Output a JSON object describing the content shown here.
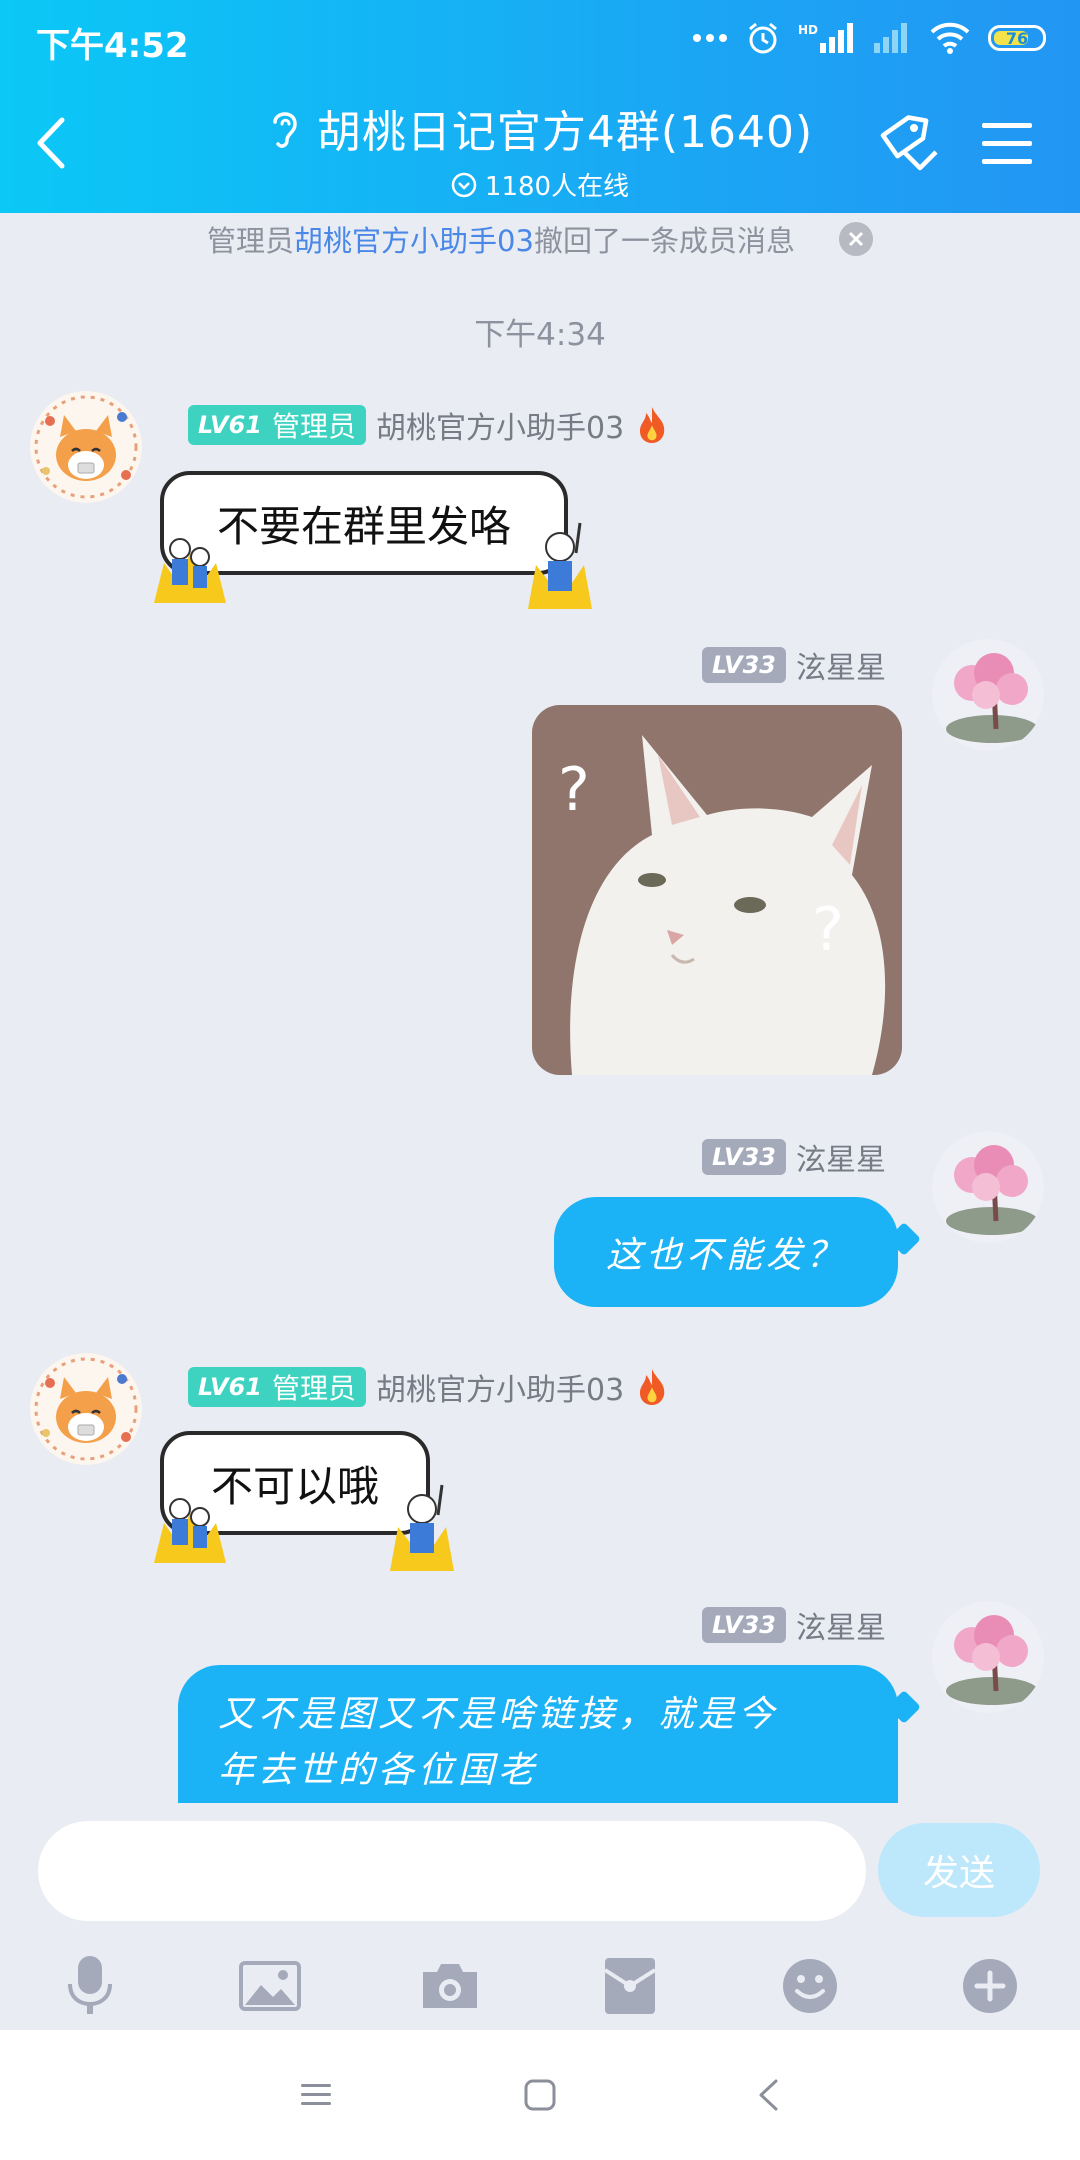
{
  "status_bar": {
    "time": "下午4:52",
    "battery": "76",
    "network": "HD"
  },
  "header": {
    "title": "胡桃日记官方4群(1640)",
    "online": "1180人在线"
  },
  "system_notice": {
    "prefix": "管理员",
    "name": "胡桃官方小助手03",
    "suffix": "撤回了一条成员消息"
  },
  "timestamp": "下午4:34",
  "messages": [
    {
      "sender": "胡桃官方小助手03",
      "level": "LV61",
      "role": "管理员",
      "text": "不要在群里发咯"
    },
    {
      "sender": "泫星星",
      "level": "LV33",
      "image_marks": [
        "?",
        "?"
      ]
    },
    {
      "sender": "泫星星",
      "level": "LV33",
      "text": "这也不能发？"
    },
    {
      "sender": "胡桃官方小助手03",
      "level": "LV61",
      "role": "管理员",
      "text": "不可以哦"
    },
    {
      "sender": "泫星星",
      "level": "LV33",
      "text_line1": "又不是图又不是啥链接，就是今",
      "text_line2": "年去世的各位国老"
    }
  ],
  "input": {
    "value": "",
    "send_label": "发送"
  },
  "colors": {
    "accent": "#1bb3f6",
    "admin_badge": "#3dd3c0",
    "level_badge": "#a5aabb"
  }
}
